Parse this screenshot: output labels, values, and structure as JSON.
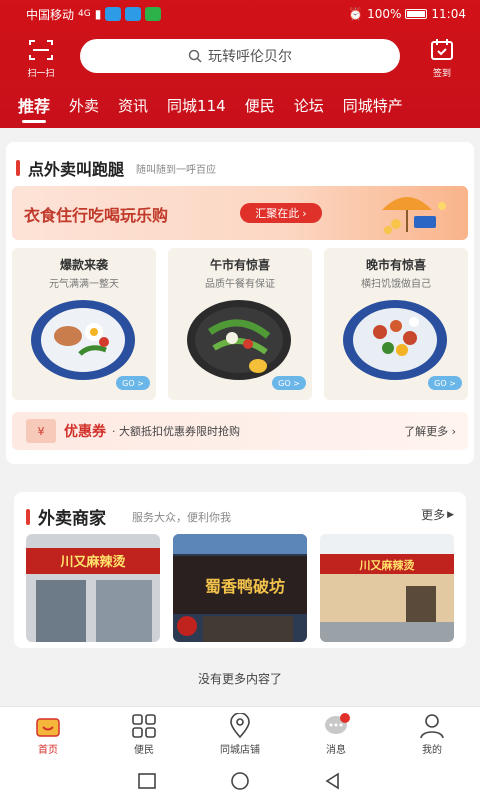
{
  "status": {
    "carrier": "中国移动",
    "network": "4G",
    "battery": "100%",
    "time": "11:04"
  },
  "header": {
    "scan_label": "扫一扫",
    "search_placeholder": "玩转呼伦贝尔",
    "sign_label": "签到"
  },
  "tabs": [
    "推荐",
    "外卖",
    "资讯",
    "同城114",
    "便民",
    "论坛",
    "同城特产"
  ],
  "errand": {
    "title": "点外卖叫跑腿",
    "subtitle": "随叫随到一呼百应",
    "banner_text": "衣食住行吃喝玩乐购",
    "banner_button": "汇聚在此",
    "cards": [
      {
        "title": "爆款来袭",
        "sub": "元气满满一整天",
        "go": "GO"
      },
      {
        "title": "午市有惊喜",
        "sub": "品质午餐有保证",
        "go": "GO"
      },
      {
        "title": "晚市有惊喜",
        "sub": "横扫饥饿做自己",
        "go": "GO"
      }
    ]
  },
  "coupon": {
    "icon_text": "¥",
    "title": "优惠券",
    "desc": "· 大额抵扣优惠券限时抢购",
    "more": "了解更多"
  },
  "merchants": {
    "title": "外卖商家",
    "subtitle": "服务大众，便利你我",
    "more": "更多",
    "stores": [
      {
        "sign": "川又麻辣烫"
      },
      {
        "sign": "蜀香鸭破坊"
      },
      {
        "sign": "川又麻辣烫"
      }
    ]
  },
  "footer_text": "没有更多内容了",
  "bottom_nav": [
    {
      "label": "首页",
      "icon": "home-icon"
    },
    {
      "label": "便民",
      "icon": "grid-icon"
    },
    {
      "label": "同城店铺",
      "icon": "location-icon"
    },
    {
      "label": "消息",
      "icon": "message-icon"
    },
    {
      "label": "我的",
      "icon": "user-icon"
    }
  ],
  "colors": {
    "brand_red": "#d11218",
    "accent_red": "#e0302a",
    "go_blue": "#6bb6e8"
  }
}
